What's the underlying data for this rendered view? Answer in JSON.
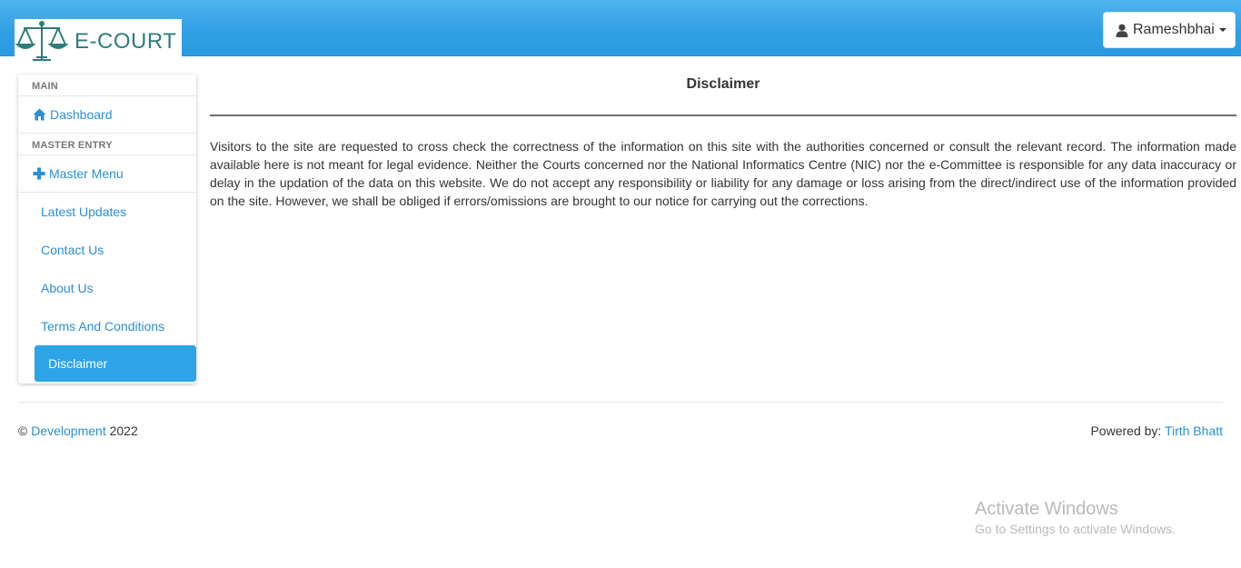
{
  "header": {
    "logo_text": "E-COURT",
    "user_name": "Rameshbhai",
    "user_icon": "user-icon"
  },
  "sidebar": {
    "sections": [
      {
        "heading": "MAIN"
      },
      {
        "heading": "MASTER ENTRY"
      }
    ],
    "main_item": {
      "label": "Dashboard",
      "icon": "home-icon"
    },
    "master_item": {
      "label": "Master Menu",
      "icon": "plus-icon"
    },
    "sub_items": [
      {
        "label": "Latest Updates"
      },
      {
        "label": "Contact Us"
      },
      {
        "label": "About Us"
      },
      {
        "label": "Terms And Conditions"
      },
      {
        "label": "Disclaimer",
        "active": true
      }
    ]
  },
  "main": {
    "title": "Disclaimer",
    "body": "Visitors to the site are requested to cross check the correctness of the information on this site with the authorities concerned or consult the relevant record. The information made available here is not meant for legal evidence. Neither the Courts concerned nor the National Informatics Centre (NIC) nor the e-Committee is responsible for any data inaccuracy or delay in the updation of the data on this website. We do not accept any responsibility or liability for any damage or loss arising from the direct/indirect use of the information provided on the site. However, we shall be obliged if errors/omissions are brought to our notice for carrying out the corrections."
  },
  "footer": {
    "copyright_symbol": "©",
    "dev_link": "Development",
    "year": "2022",
    "powered_label": "Powered by:",
    "author_link": "Tirth Bhatt"
  },
  "watermark": {
    "title": "Activate Windows",
    "subtitle": "Go to Settings to activate Windows."
  },
  "colors": {
    "header_blue": "#2f9fe4",
    "link_blue": "#2a8fd4",
    "active_blue": "#2ea3e8",
    "logo_teal": "#2e7c7c"
  }
}
